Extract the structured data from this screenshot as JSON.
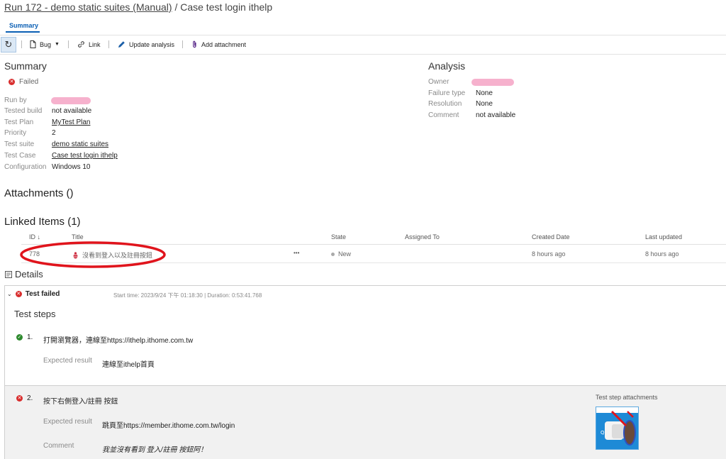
{
  "breadcrumb": {
    "run_link": "Run 172 - demo static suites (Manual)",
    "sep": " / ",
    "case": "Case test login ithelp"
  },
  "tabs": {
    "summary": "Summary"
  },
  "toolbar": {
    "bug": "Bug",
    "link": "Link",
    "update": "Update analysis",
    "attach": "Add attachment"
  },
  "summary": {
    "heading": "Summary",
    "status": "Failed",
    "fields": [
      {
        "label": "Run by",
        "value": ""
      },
      {
        "label": "Tested build",
        "value": "not available"
      },
      {
        "label": "Test Plan",
        "value": "MyTest Plan"
      },
      {
        "label": "Priority",
        "value": "2"
      },
      {
        "label": "Test suite",
        "value": "demo static suites"
      },
      {
        "label": "Test Case",
        "value": "Case test login ithelp"
      },
      {
        "label": "Configuration",
        "value": "Windows 10"
      }
    ]
  },
  "analysis": {
    "heading": "Analysis",
    "fields": [
      {
        "label": "Owner",
        "value": ""
      },
      {
        "label": "Failure type",
        "value": "None"
      },
      {
        "label": "Resolution",
        "value": "None"
      },
      {
        "label": "Comment",
        "value": "not available"
      }
    ]
  },
  "attachments": {
    "heading": "Attachments ()"
  },
  "linked": {
    "heading": "Linked Items (1)",
    "columns": {
      "id": "ID",
      "title": "Title",
      "state": "State",
      "assigned": "Assigned To",
      "created": "Created Date",
      "updated": "Last updated"
    },
    "rows": [
      {
        "id": "778",
        "title": "沒看到登入以及註冊按鈕",
        "more": "•••",
        "state": "New",
        "assigned": "",
        "created": "8 hours ago",
        "updated": "8 hours ago"
      }
    ]
  },
  "details": {
    "heading": "Details",
    "result": "Test failed",
    "meta": "Start time: 2023/9/24 下午 01:18:30 | Duration: 0:53:41.768",
    "steps_heading": "Test steps",
    "expected_label": "Expected result",
    "comment_label": "Comment",
    "attachments_label": "Test step attachments",
    "steps": [
      {
        "num": "1.",
        "action": "打開瀏覽器，連線至https://ithelp.ithome.com.tw",
        "expected": "連線至ithelp首頁",
        "status": "passed"
      },
      {
        "num": "2.",
        "action": "按下右側登入/註冊 按鈕",
        "expected": "跳頁至https://member.ithome.com.tw/login",
        "comment": "我並沒有看到 登入/註冊 按鈕阿！",
        "status": "failed"
      }
    ]
  },
  "colors": {
    "accent": "#0a5fb4",
    "error": "#d82c2c",
    "success": "#2e8a2e",
    "annotation": "#e0141c"
  }
}
